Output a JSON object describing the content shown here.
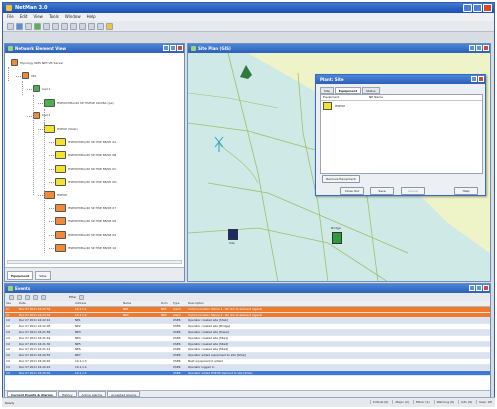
{
  "window": {
    "title": "NetMan 3.0"
  },
  "menu": [
    "File",
    "Edit",
    "View",
    "Tools",
    "Window",
    "Help"
  ],
  "network_panel": {
    "title": "Network Element View",
    "tabs": [
      "Equipment",
      "Sites"
    ],
    "nodes": [
      {
        "label": "Topology NMS NET.VR Server",
        "color": "#f08a3a",
        "depth": 0
      },
      {
        "label": "VPs",
        "color": "#f08a3a",
        "depth": 1
      },
      {
        "label": "Cell 1",
        "color": "#4caf50",
        "depth": 2
      },
      {
        "label": "HSEUP/MSL/40 SP HSHSE 00/08A (pe)",
        "color": "#4caf50",
        "depth": 3
      },
      {
        "label": "Cell 2",
        "color": "#f08a3a",
        "depth": 2
      },
      {
        "label": "HSEUP (Shsb)",
        "color": "#f2e232",
        "depth": 3
      },
      {
        "label": "HSEUP/MSL/40 SP HSE 88/00 0A",
        "color": "#f2e232",
        "depth": 4
      },
      {
        "label": "HSEUP/MSL/40 SP HSE 88/00 0B",
        "color": "#f2e232",
        "depth": 4
      },
      {
        "label": "HSEUP/MSL/40 SP HSE 88/00 0C",
        "color": "#f2e232",
        "depth": 4
      },
      {
        "label": "HSEUP/MSL/40 SP HSE 88/00 0D",
        "color": "#f2e232",
        "depth": 4
      },
      {
        "label": "HSEUP",
        "color": "#f08a3a",
        "depth": 3
      },
      {
        "label": "HSEUP/MSL/40 SP HSE 88/08 07",
        "color": "#f08a3a",
        "depth": 4
      },
      {
        "label": "HSEUP/MSL/40 SP HSE 88/08 08",
        "color": "#f08a3a",
        "depth": 4
      },
      {
        "label": "HSEUP/MSL/40 SP HSE 88/08 09",
        "color": "#f08a3a",
        "depth": 4
      },
      {
        "label": "HSEUP/MSL/40 SP HSE 88/08 10",
        "color": "#f08a3a",
        "depth": 4
      }
    ]
  },
  "map_panel": {
    "title": "Site Plan (GIS)",
    "sites": [
      {
        "label": "Site",
        "color": "#1a2a6a"
      },
      {
        "label": "Bridge",
        "color": "#2f9a3a"
      }
    ]
  },
  "dialog": {
    "title": "Plant: Site",
    "tabs": [
      "Site",
      "Equipment",
      "Status"
    ],
    "columns": [
      "Equipment",
      "NE Name"
    ],
    "rows": [
      {
        "name": "HSEUP",
        "ne": ""
      }
    ],
    "side_button": "Remove Equipment",
    "buttons": [
      "Close Out",
      "Save",
      "Cancel",
      "Help"
    ]
  },
  "events_panel": {
    "title": "Events",
    "toolbar_label": "Filter",
    "columns": [
      "Sev",
      "Date",
      "Address",
      "Name",
      "Dom",
      "Type",
      "Description"
    ],
    "rows": [
      {
        "style": "orange",
        "cells": [
          "Cr.",
          "Dec 07 2011 16:23:34",
          "10.1.1.1",
          "NE1",
          "NE1",
          "Alarm",
          "Communication failure 1 - No link to element (agent)"
        ]
      },
      {
        "style": "orange",
        "cells": [
          "Cr.",
          "Dec 07 2011 16:23:34",
          "10.1.1.2",
          "NE2",
          "NE2",
          "Alarm",
          "Communication failure 2 - No link to element (agent)"
        ]
      },
      {
        "style": "alt",
        "cells": [
          "Inf.",
          "Dec 07 2011 16:22:10",
          "NE1",
          "",
          "",
          "USER",
          "Operator created site [Shsb]"
        ]
      },
      {
        "style": "",
        "cells": [
          "Inf.",
          "Dec 07 2011 16:22:05",
          "NE2",
          "",
          "",
          "USER",
          "Operator created site [Bridge]"
        ]
      },
      {
        "style": "alt",
        "cells": [
          "Inf.",
          "Dec 07 2011 16:21:58",
          "NE3",
          "",
          "",
          "USER",
          "Operator created site [Tower]"
        ]
      },
      {
        "style": "",
        "cells": [
          "Inf.",
          "Dec 07 2011 16:21:44",
          "NE4",
          "",
          "",
          "USER",
          "Operator created site [Site1]"
        ]
      },
      {
        "style": "alt",
        "cells": [
          "Inf.",
          "Dec 07 2011 16:21:30",
          "NE5",
          "",
          "",
          "USER",
          "Operator created site [Site2]"
        ]
      },
      {
        "style": "",
        "cells": [
          "Inf.",
          "Dec 07 2011 16:21:12",
          "NE6",
          "",
          "",
          "USER",
          "Operator created site [Site3]"
        ]
      },
      {
        "style": "alt",
        "cells": [
          "Inf.",
          "Dec 07 2011 16:20:55",
          "NE7",
          "",
          "",
          "USER",
          "Operator added equipment to site [Shsb]"
        ]
      },
      {
        "style": "",
        "cells": [
          "Inf.",
          "Dec 07 2011 16:20:40",
          "10.1.1.3",
          "",
          "",
          "USER",
          "Next equipment 0 added"
        ]
      },
      {
        "style": "alt",
        "cells": [
          "Inf.",
          "Dec 07 2011 16:20:22",
          "10.1.1.4",
          "",
          "",
          "USER",
          "Operator logged in"
        ]
      },
      {
        "style": "selected",
        "cells": [
          "Inf.",
          "Dec 07 2011 16:20:01",
          "10.1.1.5",
          "",
          "",
          "USER",
          "Operator added HSEUP element to site [Shsb]"
        ]
      }
    ],
    "tabs": [
      "Current Events & Alarms",
      "History",
      "Active Alarms",
      "Accepted Alarms"
    ]
  },
  "status": {
    "left": "Ready",
    "cells": [
      "Critical (0)",
      "Major (2)",
      "Minor (1)",
      "Warning (0)",
      "Info (9)",
      "User: OP"
    ]
  }
}
